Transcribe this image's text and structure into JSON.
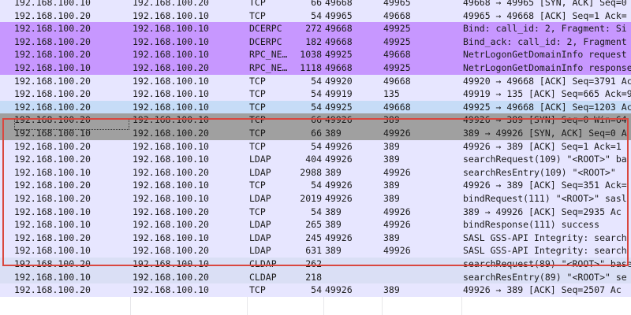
{
  "packets": [
    {
      "src": "192.168.100.10",
      "dst": "192.168.100.20",
      "proto": "TCP",
      "len": "66",
      "sport": "49668",
      "dport": "49965",
      "info": "49668 → 49965 [SYN, ACK] Seq=0",
      "style": "tcp"
    },
    {
      "src": "192.168.100.20",
      "dst": "192.168.100.10",
      "proto": "TCP",
      "len": "54",
      "sport": "49965",
      "dport": "49668",
      "info": "49965 → 49668 [ACK] Seq=1 Ack=",
      "style": "tcp"
    },
    {
      "src": "192.168.100.20",
      "dst": "192.168.100.10",
      "proto": "DCERPC",
      "len": "272",
      "sport": "49668",
      "dport": "49925",
      "info": "Bind: call_id: 2, Fragment: Si",
      "style": "dcerpc"
    },
    {
      "src": "192.168.100.20",
      "dst": "192.168.100.10",
      "proto": "DCERPC",
      "len": "182",
      "sport": "49668",
      "dport": "49925",
      "info": "Bind_ack: call_id: 2, Fragment",
      "style": "dcerpc"
    },
    {
      "src": "192.168.100.20",
      "dst": "192.168.100.10",
      "proto": "RPC_NE…",
      "len": "1038",
      "sport": "49925",
      "dport": "49668",
      "info": "NetrLogonGetDomainInfo request",
      "style": "dcerpc"
    },
    {
      "src": "192.168.100.10",
      "dst": "192.168.100.20",
      "proto": "RPC_NE…",
      "len": "1118",
      "sport": "49668",
      "dport": "49925",
      "info": "NetrLogonGetDomainInfo response",
      "style": "dcerpc"
    },
    {
      "src": "192.168.100.20",
      "dst": "192.168.100.10",
      "proto": "TCP",
      "len": "54",
      "sport": "49920",
      "dport": "49668",
      "info": "49920 → 49668 [ACK] Seq=3791 Ac",
      "style": "tcp"
    },
    {
      "src": "192.168.100.20",
      "dst": "192.168.100.10",
      "proto": "TCP",
      "len": "54",
      "sport": "49919",
      "dport": "135",
      "info": "49919 → 135 [ACK] Seq=665 Ack=9",
      "style": "tcp"
    },
    {
      "src": "192.168.100.20",
      "dst": "192.168.100.10",
      "proto": "TCP",
      "len": "54",
      "sport": "49925",
      "dport": "49668",
      "info": "49925 → 49668 [ACK] Seq=1203 Ac",
      "style": "tcp-blue"
    },
    {
      "src": "192.168.100.20",
      "dst": "192.168.100.10",
      "proto": "TCP",
      "len": "66",
      "sport": "49926",
      "dport": "389",
      "info": "49926 → 389 [SYN] Seq=0 Win=64",
      "style": "syn"
    },
    {
      "src": "192.168.100.10",
      "dst": "192.168.100.20",
      "proto": "TCP",
      "len": "66",
      "sport": "389",
      "dport": "49926",
      "info": "389 → 49926 [SYN, ACK] Seq=0 A",
      "style": "syn"
    },
    {
      "src": "192.168.100.20",
      "dst": "192.168.100.10",
      "proto": "TCP",
      "len": "54",
      "sport": "49926",
      "dport": "389",
      "info": "49926 → 389 [ACK] Seq=1 Ack=1",
      "style": "tcp"
    },
    {
      "src": "192.168.100.20",
      "dst": "192.168.100.10",
      "proto": "LDAP",
      "len": "404",
      "sport": "49926",
      "dport": "389",
      "info": "searchRequest(109) \"<ROOT>\" ba",
      "style": "ldap"
    },
    {
      "src": "192.168.100.10",
      "dst": "192.168.100.20",
      "proto": "LDAP",
      "len": "2988",
      "sport": "389",
      "dport": "49926",
      "info": "searchResEntry(109) \"<ROOT>\"",
      "style": "ldap"
    },
    {
      "src": "192.168.100.20",
      "dst": "192.168.100.10",
      "proto": "TCP",
      "len": "54",
      "sport": "49926",
      "dport": "389",
      "info": "49926 → 389 [ACK] Seq=351 Ack=",
      "style": "tcp"
    },
    {
      "src": "192.168.100.20",
      "dst": "192.168.100.10",
      "proto": "LDAP",
      "len": "2019",
      "sport": "49926",
      "dport": "389",
      "info": "bindRequest(111) \"<ROOT>\" sasl",
      "style": "ldap"
    },
    {
      "src": "192.168.100.10",
      "dst": "192.168.100.20",
      "proto": "TCP",
      "len": "54",
      "sport": "389",
      "dport": "49926",
      "info": "389 → 49926 [ACK] Seq=2935 Ac",
      "style": "tcp"
    },
    {
      "src": "192.168.100.10",
      "dst": "192.168.100.20",
      "proto": "LDAP",
      "len": "265",
      "sport": "389",
      "dport": "49926",
      "info": "bindResponse(111) success",
      "style": "ldap"
    },
    {
      "src": "192.168.100.20",
      "dst": "192.168.100.10",
      "proto": "LDAP",
      "len": "245",
      "sport": "49926",
      "dport": "389",
      "info": "SASL GSS-API Integrity: search",
      "style": "ldap"
    },
    {
      "src": "192.168.100.10",
      "dst": "192.168.100.20",
      "proto": "LDAP",
      "len": "631",
      "sport": "389",
      "dport": "49926",
      "info": "SASL GSS-API Integrity: search",
      "style": "ldap"
    },
    {
      "src": "192.168.100.20",
      "dst": "192.168.100.10",
      "proto": "CLDAP",
      "len": "262",
      "sport": "",
      "dport": "",
      "info": "searchRequest(89) \"<ROOT>\" base",
      "style": "cldap"
    },
    {
      "src": "192.168.100.10",
      "dst": "192.168.100.20",
      "proto": "CLDAP",
      "len": "218",
      "sport": "",
      "dport": "",
      "info": "searchResEntry(89) \"<ROOT>\" se",
      "style": "cldap"
    },
    {
      "src": "192.168.100.20",
      "dst": "192.168.100.10",
      "proto": "TCP",
      "len": "54",
      "sport": "49926",
      "dport": "389",
      "info": "49926 → 389 [ACK] Seq=2507 Ac",
      "style": "tcp"
    }
  ],
  "colors": {
    "tcp": "#e7e6ff",
    "dcerpc": "#c797ff",
    "syn": "#a0a0a0",
    "highlight_box": "#d9473f"
  }
}
